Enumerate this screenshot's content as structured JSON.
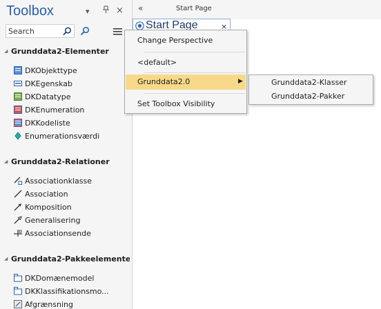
{
  "toolbox": {
    "title": "Toolbox",
    "dropdown_glyph": "▾",
    "pin_glyph": "ᵖ",
    "close_glyph": "×",
    "search_placeholder": "Search",
    "groups": [
      {
        "label": "Grunddata2-Elementer",
        "items": [
          {
            "label": "DKObjekttype",
            "icon": "class-icon"
          },
          {
            "label": "DKEgenskab",
            "icon": "attribute-icon"
          },
          {
            "label": "DKDatatype",
            "icon": "datatype-icon"
          },
          {
            "label": "DKEnumeration",
            "icon": "enumeration-icon"
          },
          {
            "label": "DKKodeliste",
            "icon": "codelist-icon"
          },
          {
            "label": "Enumerationsværdi",
            "icon": "enum-value-icon"
          }
        ]
      },
      {
        "label": "Grunddata2-Relationer",
        "items": [
          {
            "label": "Associationklasse",
            "icon": "association-class-icon"
          },
          {
            "label": "Association",
            "icon": "association-icon"
          },
          {
            "label": "Komposition",
            "icon": "composition-icon"
          },
          {
            "label": "Generalisering",
            "icon": "generalization-icon"
          },
          {
            "label": "Associationsende",
            "icon": "association-end-icon"
          }
        ]
      },
      {
        "label": "Grunddata2-Pakkeelemente",
        "items": [
          {
            "label": "DKDomænemodel",
            "icon": "package-icon"
          },
          {
            "label": "DKKlassifikationsmo...",
            "icon": "package-icon"
          },
          {
            "label": "Afgrænsning",
            "icon": "boundary-icon"
          }
        ]
      }
    ]
  },
  "topbar": {
    "collapse_glyph": "«",
    "start_page_label": "Start Page"
  },
  "tab": {
    "title": "Start Page",
    "close_glyph": "×"
  },
  "menu": {
    "items": [
      {
        "label": "Change Perspective"
      },
      {
        "label": "<default>"
      },
      {
        "label": "Grunddata2.0",
        "has_submenu": true
      },
      {
        "label": "Set Toolbox Visibility"
      }
    ],
    "submenu_arrow": "▶"
  },
  "submenu": {
    "items": [
      {
        "label": "Grunddata2-Klasser"
      },
      {
        "label": "Grunddata2-Pakker"
      }
    ]
  },
  "colors": {
    "title_blue": "#2a5fa8",
    "highlight": "#f7d989",
    "panel_bg": "#f5f5f5"
  }
}
